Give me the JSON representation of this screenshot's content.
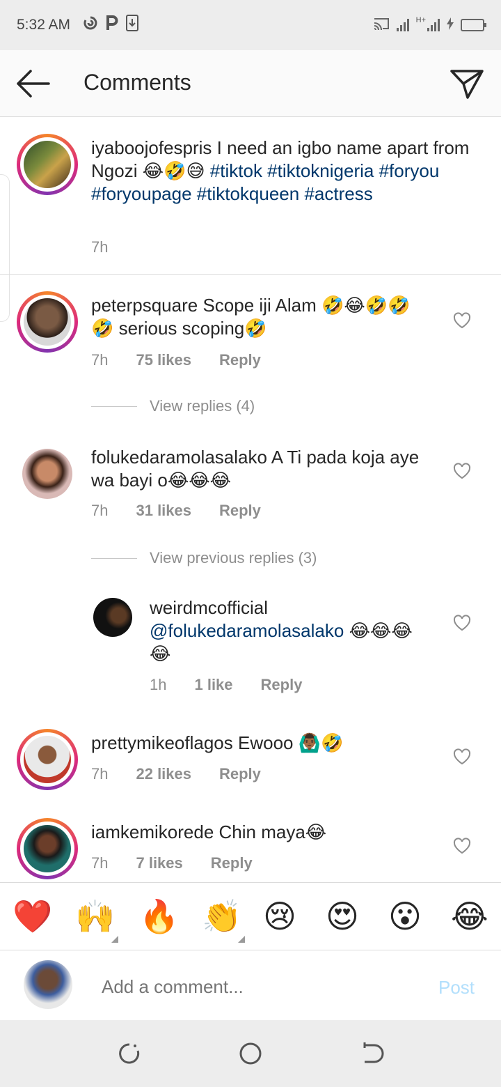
{
  "status_bar": {
    "time": "5:32 AM",
    "left_icons": [
      "spiral-icon",
      "p-icon",
      "download-icon"
    ],
    "right_icons": [
      "cast-icon",
      "signal-icon",
      "signal-h-icon",
      "battery-icon"
    ],
    "network": "H+"
  },
  "header": {
    "title": "Comments",
    "back_icon": "arrow-left-icon",
    "action_icon": "send-icon"
  },
  "caption": {
    "username": "iyaboojofespris",
    "text": "I need an igbo name apart from Ngozi 😂🤣😅",
    "hashtags": "#tiktok #tiktoknigeria #foryou #foryoupage #tiktokqueen #actress",
    "time": "7h"
  },
  "comments": [
    {
      "username": "peterpsquare",
      "text": "Scope iji Alam 🤣😂🤣🤣🤣 serious scoping🤣",
      "time": "7h",
      "likes": "75 likes",
      "reply": "Reply",
      "view_replies": "View replies (4)"
    },
    {
      "username": "folukedaramolasalako",
      "text": "A Ti pada koja aye wa bayi o😂😂😂",
      "time": "7h",
      "likes": "31 likes",
      "reply": "Reply",
      "view_replies": "View previous replies (3)",
      "reply_item": {
        "username": "weirdmcofficial",
        "mention": "@folukedaramolasalako",
        "text": "😂😂😂😂",
        "time": "1h",
        "likes": "1 like",
        "reply": "Reply"
      }
    },
    {
      "username": "prettymikeoflagos",
      "text": "Ewooo 🙆🏾‍♂️🤣",
      "time": "7h",
      "likes": "22 likes",
      "reply": "Reply"
    },
    {
      "username": "iamkemikorede",
      "text": "Chin maya😂",
      "time": "7h",
      "likes": "7 likes",
      "reply": "Reply"
    }
  ],
  "reactions": [
    "❤️",
    "🙌",
    "🔥",
    "👏",
    "😢",
    "😍",
    "😮",
    "😂"
  ],
  "compose": {
    "placeholder": "Add a comment...",
    "post_label": "Post"
  },
  "colors": {
    "link": "#00376b",
    "meta": "#8e8e8e",
    "post_disabled": "#b2dffc"
  },
  "nav": [
    "recents-icon",
    "home-icon",
    "back-icon"
  ]
}
